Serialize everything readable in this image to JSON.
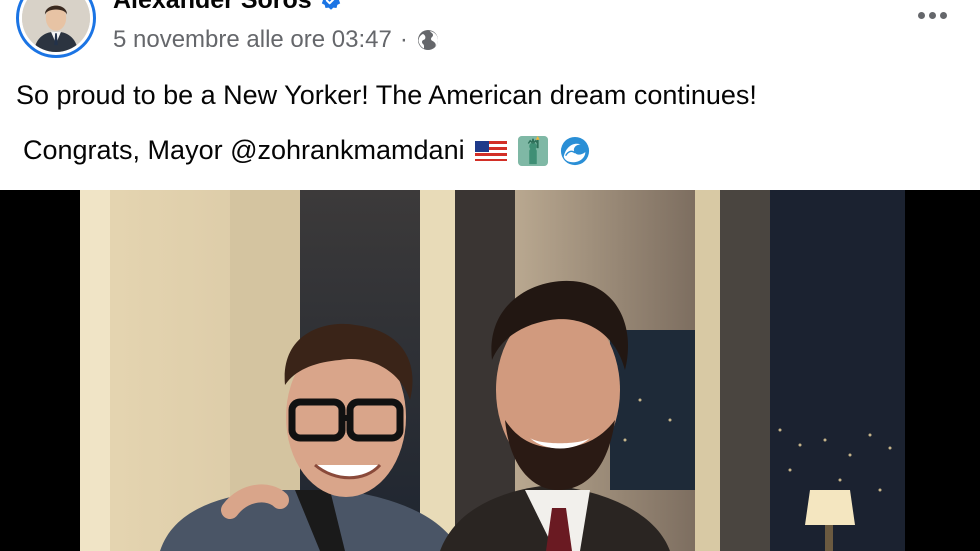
{
  "post": {
    "author": "Alexander Soros",
    "timestamp": "5 novembre alle ore 03:47",
    "separator": "·",
    "audience_icon": "globe-icon",
    "verified_icon": "verified-badge-icon",
    "more_icon": "more-horizontal-icon",
    "text_line_1": "So proud to be a New Yorker! The American dream continues!",
    "text_line_2": "Congrats, Mayor @zohrankmamdani",
    "emojis": [
      "us-flag-emoji",
      "statue-of-liberty-emoji",
      "wave-emoji"
    ]
  },
  "colors": {
    "brand_blue": "#1b74e4",
    "meta_gray": "#65676b",
    "text": "#050505",
    "photo_letterbox": "#000000"
  }
}
